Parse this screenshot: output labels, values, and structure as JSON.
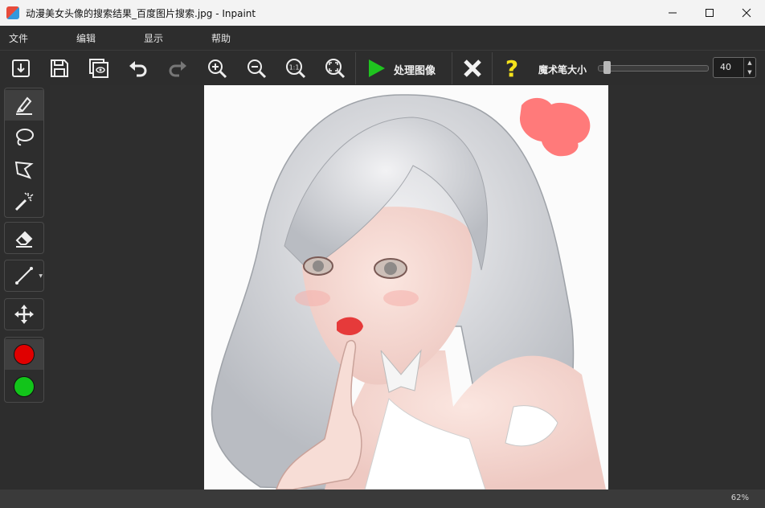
{
  "window": {
    "title": "动漫美女头像的搜索结果_百度图片搜索.jpg - Inpaint"
  },
  "menu": {
    "items": [
      "文件",
      "编辑",
      "显示",
      "帮助"
    ]
  },
  "toolbar": {
    "process_label": "处理图像",
    "brush_size_label": "魔术笔大小",
    "brush_size_value": "40",
    "brush_size_fraction": 0.08,
    "buttons": [
      "open-icon",
      "save-icon",
      "save-preview-icon",
      "undo-icon",
      "redo-icon",
      "zoom-in-icon",
      "zoom-out-icon",
      "zoom-actual-icon",
      "zoom-fit-icon",
      "play-icon",
      "close-icon",
      "help-icon"
    ]
  },
  "tools": {
    "items": [
      "marker-icon",
      "lasso-icon",
      "polygon-lasso-icon",
      "magic-wand-icon",
      "eraser-icon",
      "line-icon",
      "move-icon"
    ],
    "colors": {
      "mask": "#e00000",
      "keep": "#12c41a"
    }
  },
  "status": {
    "zoom": "62%"
  },
  "colors": {
    "play": "#1fc41f",
    "help": "#f5e21b",
    "mask_overlay": "#ff7a7a"
  }
}
